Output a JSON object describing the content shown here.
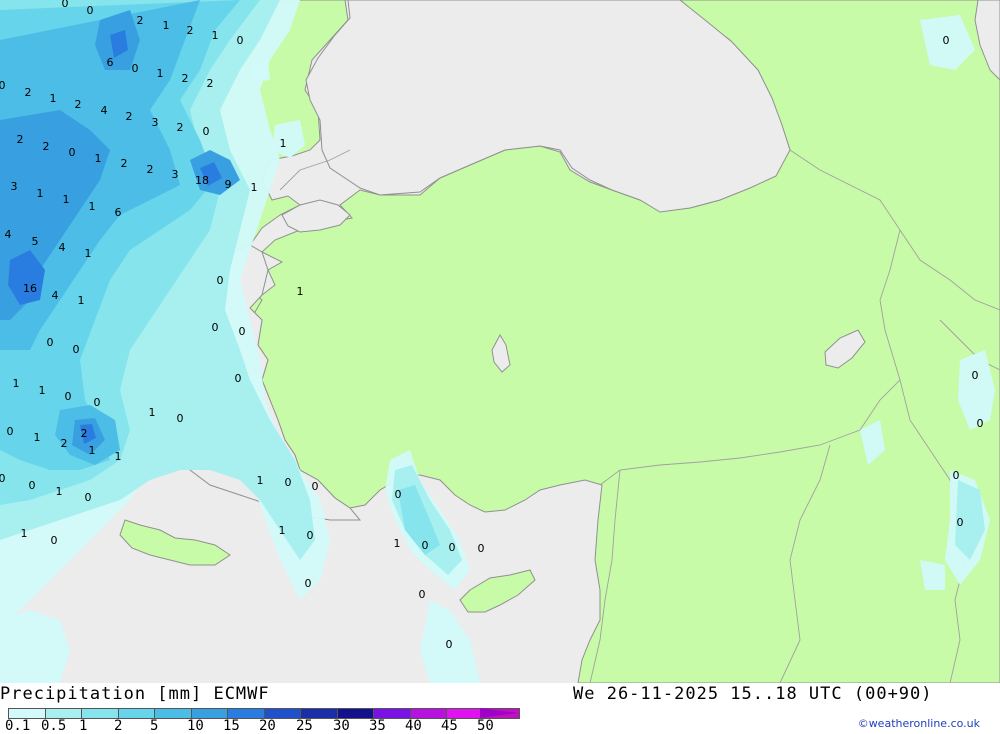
{
  "title": "Precipitation [mm] ECMWF",
  "valid_time": "We 26-11-2025 15..18 UTC (00+90)",
  "credit": "©weatheronline.co.uk",
  "colors": {
    "sea": "#ececec",
    "land": "#c8fba8",
    "border": "#a0a0a0",
    "coast": "#909090"
  },
  "legend": {
    "values": [
      "0.1",
      "0.5",
      "1",
      "2",
      "5",
      "10",
      "15",
      "20",
      "25",
      "30",
      "35",
      "40",
      "45",
      "50"
    ],
    "colors": [
      "#d2fafa",
      "#a8f0f0",
      "#86e4ec",
      "#66d4ea",
      "#4cbde6",
      "#38a0e0",
      "#2a7de0",
      "#2050cc",
      "#1a2ea8",
      "#12128c",
      "#7a12e8",
      "#b812e0",
      "#e012f0",
      "#c010c0"
    ]
  },
  "map_labels": [
    {
      "t": "0"
    },
    {
      "t": "0"
    },
    {
      "t": "2"
    },
    {
      "t": "1"
    },
    {
      "t": "2"
    },
    {
      "t": "1"
    },
    {
      "t": "0"
    },
    {
      "t": "6"
    },
    {
      "t": "0"
    },
    {
      "t": "1"
    },
    {
      "t": "2"
    },
    {
      "t": "2"
    },
    {
      "t": "0"
    },
    {
      "t": "2"
    },
    {
      "t": "1"
    },
    {
      "t": "2"
    },
    {
      "t": "4"
    },
    {
      "t": "2"
    },
    {
      "t": "3"
    },
    {
      "t": "2"
    },
    {
      "t": "0"
    },
    {
      "t": "2"
    },
    {
      "t": "2"
    },
    {
      "t": "0"
    },
    {
      "t": "1"
    },
    {
      "t": "2"
    },
    {
      "t": "2"
    },
    {
      "t": "3"
    },
    {
      "t": "18"
    },
    {
      "t": "9"
    },
    {
      "t": "1"
    },
    {
      "t": "1"
    },
    {
      "t": "3"
    },
    {
      "t": "1"
    },
    {
      "t": "1"
    },
    {
      "t": "1"
    },
    {
      "t": "6"
    },
    {
      "t": "4"
    },
    {
      "t": "5"
    },
    {
      "t": "4"
    },
    {
      "t": "1"
    },
    {
      "t": "0"
    },
    {
      "t": "1"
    },
    {
      "t": "16"
    },
    {
      "t": "4"
    },
    {
      "t": "1"
    },
    {
      "t": "0"
    },
    {
      "t": "0"
    },
    {
      "t": "0"
    },
    {
      "t": "0"
    },
    {
      "t": "1"
    },
    {
      "t": "1"
    },
    {
      "t": "0"
    },
    {
      "t": "0"
    },
    {
      "t": "0"
    },
    {
      "t": "1"
    },
    {
      "t": "0"
    },
    {
      "t": "0"
    },
    {
      "t": "1"
    },
    {
      "t": "2"
    },
    {
      "t": "2"
    },
    {
      "t": "1"
    },
    {
      "t": "1"
    },
    {
      "t": "0"
    },
    {
      "t": "0"
    },
    {
      "t": "1"
    },
    {
      "t": "0"
    },
    {
      "t": "1"
    },
    {
      "t": "0"
    },
    {
      "t": "0"
    },
    {
      "t": "1"
    },
    {
      "t": "0"
    },
    {
      "t": "1"
    },
    {
      "t": "1"
    },
    {
      "t": "0"
    },
    {
      "t": "0"
    },
    {
      "t": "0"
    },
    {
      "t": "0"
    },
    {
      "t": "0"
    },
    {
      "t": "0"
    },
    {
      "t": "0"
    },
    {
      "t": "0"
    },
    {
      "t": "0"
    },
    {
      "t": "0"
    },
    {
      "t": "0"
    },
    {
      "t": "0"
    },
    {
      "t": "0"
    }
  ]
}
